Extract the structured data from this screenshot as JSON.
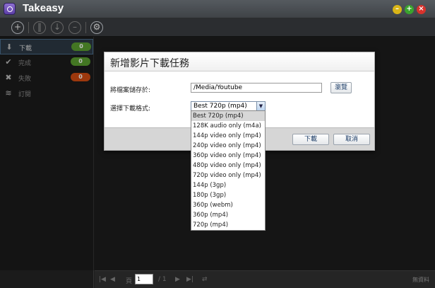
{
  "app": {
    "title": "Takeasy"
  },
  "toolbar": {
    "icons": [
      "plus-icon",
      "pause-icon",
      "download-icon",
      "delete-icon",
      "gear-icon"
    ]
  },
  "sidebar": {
    "items": [
      {
        "label": "下載",
        "count": "0",
        "badge_color": "#5a9e2f"
      },
      {
        "label": "完成",
        "count": "0",
        "badge_color": "#5a9e2f"
      },
      {
        "label": "失敗",
        "count": "0",
        "badge_color": "#d14b12"
      },
      {
        "label": "訂閱",
        "count": ""
      }
    ]
  },
  "dialog": {
    "title": "新增影片下載任務",
    "save_label": "將檔案儲存於:",
    "save_path": "/Media/Youtube",
    "browse_label": "瀏覽",
    "format_label": "選擇下載格式:",
    "format_selected": "Best 720p (mp4)",
    "ok_label": "下載",
    "cancel_label": "取消"
  },
  "format_options": [
    "Best 720p (mp4)",
    "128K audio only (m4a)",
    "144p video only (mp4)",
    "240p video only (mp4)",
    "360p video only (mp4)",
    "480p video only (mp4)",
    "720p video only (mp4)",
    "144p (3gp)",
    "180p (3gp)",
    "360p (webm)",
    "360p (mp4)",
    "720p (mp4)"
  ],
  "footer": {
    "page_label": "頁",
    "page_value": "1",
    "page_total": "/ 1",
    "no_data": "無資料"
  },
  "colors": {
    "accent_blue": "#4a6d8c",
    "badge_green": "#5a9e2f",
    "badge_orange": "#d14b12"
  }
}
